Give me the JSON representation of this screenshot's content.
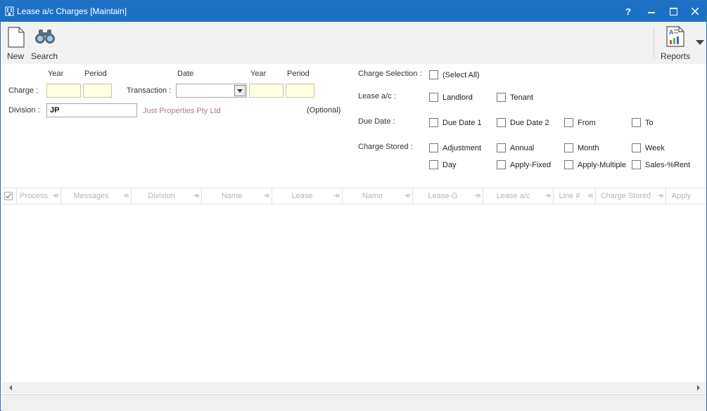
{
  "window": {
    "title": "Lease a/c Charges [Maintain]",
    "help_label": "?"
  },
  "toolbar": {
    "new_label": "New",
    "search_label": "Search",
    "reports_label": "Reports"
  },
  "form": {
    "year_header": "Year",
    "period_header": "Period",
    "date_header": "Date",
    "year_header_2": "Year",
    "period_header_2": "Period",
    "charge_label": "Charge :",
    "transaction_label": "Transaction :",
    "division_label": "Division :",
    "division_value": "JP",
    "division_name": "Just Properties Pty Ltd",
    "optional_label": "(Optional)"
  },
  "filters": {
    "charge_selection_label": "Charge Selection :",
    "select_all_label": "(Select All)",
    "lease_ac_label": "Lease a/c :",
    "landlord_label": "Landlord",
    "tenant_label": "Tenant",
    "due_date_label": "Due Date :",
    "due_date_1_label": "Due Date 1",
    "due_date_2_label": "Due Date 2",
    "from_label": "From",
    "to_label": "To",
    "charge_stored_label": "Charge Stored :",
    "adjustment_label": "Adjustment",
    "annual_label": "Annual",
    "month_label": "Month",
    "week_label": "Week",
    "day_label": "Day",
    "apply_fixed_label": "Apply-Fixed",
    "apply_multiple_label": "Apply-Multiple",
    "sales_rent_label": "Sales-%Rent"
  },
  "grid": {
    "columns": [
      "Process",
      "Messages",
      "Division",
      "Name",
      "Lease",
      "Name",
      "Lease-G",
      "Lease a/c",
      "Line #",
      "Charge Stored",
      "Apply"
    ]
  }
}
